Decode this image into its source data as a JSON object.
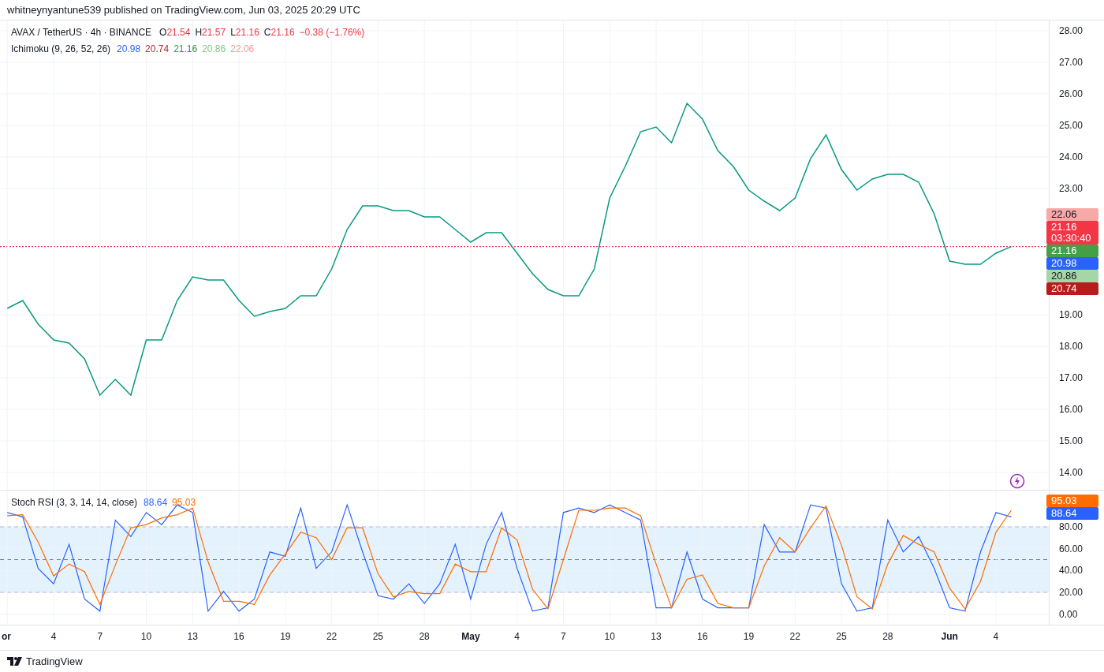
{
  "publish_line": "whitneynyantune539 published on TradingView.com, Jun 03, 2025 20:29 UTC",
  "legend": {
    "symbol": "AVAX / TetherUS · 4h · BINANCE",
    "ohlc": [
      {
        "label": "O",
        "value": "21.54"
      },
      {
        "label": "H",
        "value": "21.57"
      },
      {
        "label": "L",
        "value": "21.16"
      },
      {
        "label": "C",
        "value": "21.16"
      }
    ],
    "change": "−0.38 (−1.76%)",
    "color": "#f23645"
  },
  "ichimoku": {
    "label": "Ichimoku (9, 26, 52, 26)",
    "values": [
      {
        "text": "20.98",
        "color": "#2962ff"
      },
      {
        "text": "20.74",
        "color": "#b22833"
      },
      {
        "text": "21.16",
        "color": "#388e3c"
      },
      {
        "text": "20.86",
        "color": "#81c784"
      },
      {
        "text": "22.06",
        "color": "#ef9a9a"
      }
    ]
  },
  "price_pane": {
    "chart_data": {
      "type": "line",
      "grid": true,
      "ylim": [
        13.45,
        28.325
      ],
      "yticks": [
        {
          "value": 28,
          "label": "28.00"
        },
        {
          "value": 27,
          "label": "27.00"
        },
        {
          "value": 26,
          "label": "26.00"
        },
        {
          "value": 25,
          "label": "25.00"
        },
        {
          "value": 24,
          "label": "24.00"
        },
        {
          "value": 23,
          "label": "23.00"
        },
        {
          "value": 19,
          "label": "19.00"
        },
        {
          "value": 18,
          "label": "18.00"
        },
        {
          "value": 17,
          "label": "17.00"
        },
        {
          "value": 16,
          "label": "16.00"
        },
        {
          "value": 15,
          "label": "15.00"
        },
        {
          "value": 14,
          "label": "14.00"
        }
      ],
      "series": [
        {
          "color": "#089981",
          "values": [
            19.2,
            19.45,
            18.7,
            18.2,
            18.1,
            17.6,
            16.45,
            16.95,
            16.45,
            18.2,
            18.2,
            19.45,
            20.2,
            20.1,
            20.1,
            19.45,
            18.95,
            19.1,
            19.2,
            19.6,
            19.6,
            20.45,
            21.7,
            22.45,
            22.45,
            22.3,
            22.3,
            22.1,
            22.1,
            21.7,
            21.3,
            21.6,
            21.6,
            20.95,
            20.3,
            19.8,
            19.6,
            19.6,
            20.45,
            22.7,
            23.7,
            24.8,
            24.95,
            24.45,
            25.7,
            25.2,
            24.2,
            23.7,
            22.95,
            22.6,
            22.3,
            22.7,
            23.95,
            24.7,
            23.6,
            22.95,
            23.3,
            23.45,
            23.45,
            23.2,
            22.2,
            20.7,
            20.6,
            20.6,
            20.95,
            21.16
          ]
        }
      ]
    },
    "axis_badges": [
      {
        "text": "22.06",
        "color": "#f7a9a7",
        "kind": "light"
      },
      {
        "text": "21.16",
        "subtext": "03:30:40",
        "color": "#f23645",
        "kind": "dark"
      },
      {
        "text": "21.16",
        "color": "#43a047",
        "kind": "dark"
      },
      {
        "text": "20.98",
        "color": "#2962ff",
        "kind": "dark"
      },
      {
        "text": "20.86",
        "color": "#a5d6a7",
        "kind": "light"
      },
      {
        "text": "20.74",
        "color": "#b71c1c",
        "kind": "dark"
      }
    ]
  },
  "stoch_pane": {
    "label": "Stoch RSI (3, 3, 14, 14, close)",
    "values": [
      {
        "text": "88.64",
        "color": "#2962ff"
      },
      {
        "text": "95.03",
        "color": "#ff6d00"
      }
    ],
    "chart_data": {
      "type": "line",
      "grid": true,
      "ylim": [
        -9.4,
        113
      ],
      "yticks": [
        {
          "value": 80,
          "label": "80.00"
        },
        {
          "value": 60,
          "label": "60.00"
        },
        {
          "value": 40,
          "label": "40.00"
        },
        {
          "value": 20,
          "label": "20.00"
        },
        {
          "value": 0,
          "label": "0.00"
        }
      ],
      "categories": [
        "or",
        null,
        null,
        "4",
        null,
        null,
        "7",
        null,
        null,
        "10",
        null,
        null,
        "13",
        null,
        null,
        "16",
        null,
        null,
        "19",
        null,
        null,
        "22",
        null,
        null,
        "25",
        null,
        null,
        "28",
        null,
        null,
        "May",
        null,
        null,
        "4",
        null,
        null,
        "7",
        null,
        null,
        "10",
        null,
        null,
        "13",
        null,
        null,
        "16",
        null,
        null,
        "19",
        null,
        null,
        "22",
        null,
        null,
        "25",
        null,
        null,
        "28",
        null,
        null,
        null,
        "Jun",
        null,
        null,
        "4",
        null
      ],
      "series": [
        {
          "color": "#2962ff",
          "values": [
            93,
            89,
            42,
            28,
            64,
            14,
            3,
            86,
            71,
            93,
            82,
            100,
            93,
            3,
            21,
            3,
            14,
            57,
            53,
            97,
            42,
            57,
            100,
            57,
            17,
            14,
            28,
            10,
            28,
            64,
            14,
            64,
            93,
            42,
            3,
            6,
            93,
            97,
            93,
            100,
            93,
            86,
            6,
            6,
            57,
            14,
            6,
            6,
            6,
            82,
            57,
            57,
            100,
            97,
            28,
            3,
            6,
            86,
            57,
            71,
            42,
            6,
            3,
            57,
            93,
            89
          ]
        },
        {
          "color": "#ff6d00",
          "values": [
            90,
            91,
            66,
            35,
            46,
            39,
            9,
            45,
            79,
            82,
            88,
            91,
            97,
            48,
            12,
            12,
            9,
            36,
            55,
            75,
            70,
            50,
            79,
            79,
            37,
            16,
            21,
            19,
            19,
            46,
            39,
            39,
            79,
            68,
            23,
            5,
            50,
            95,
            95,
            97,
            97,
            90,
            46,
            6,
            32,
            36,
            10,
            6,
            6,
            44,
            70,
            57,
            79,
            99,
            63,
            16,
            5,
            46,
            72,
            64,
            57,
            24,
            5,
            30,
            75,
            95
          ]
        }
      ]
    },
    "axis_badges": [
      {
        "text": "95.03",
        "color": "#ff6d00"
      },
      {
        "text": "88.64",
        "color": "#2962ff"
      }
    ]
  },
  "footer": {
    "brand": "TradingView"
  }
}
